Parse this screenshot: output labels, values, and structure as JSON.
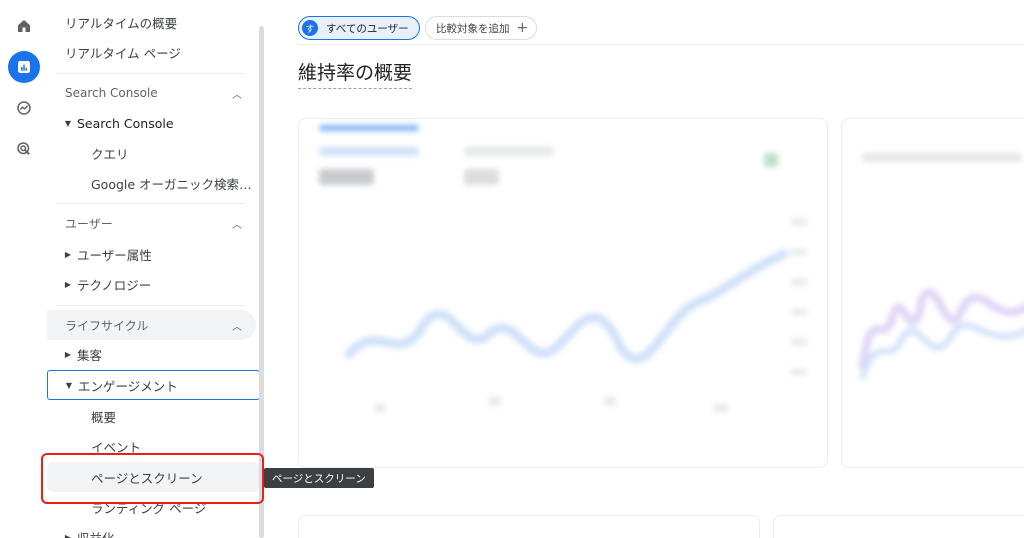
{
  "rail": {
    "icons": [
      "home-icon",
      "reports-icon",
      "explore-icon",
      "advertising-icon"
    ],
    "active": "reports-icon",
    "accent": "#1a73e8"
  },
  "sidebar": {
    "realtime_overview": "リアルタイムの概要",
    "realtime_pages": "リアルタイム ページ",
    "search_console_section": "Search Console",
    "search_console_group": "Search Console",
    "queries": "クエリ",
    "organic": "Google オーガニック検索レポート",
    "user_section": "ユーザー",
    "user_attributes": "ユーザー属性",
    "technology": "テクノロジー",
    "lifecycle_section": "ライフサイクル",
    "acquisition": "集客",
    "engagement": "エンゲージメント",
    "engagement_overview": "概要",
    "events": "イベント",
    "pages_screens": "ページとスクリーン",
    "landing_page": "ランディング ページ",
    "monetization": "収益化"
  },
  "tooltip": "ページとスクリーン",
  "main": {
    "all_users_badge": "す",
    "all_users": "すべてのユーザー",
    "add_comparison": "比較対象を追加",
    "title": "維持率の概要"
  },
  "colors": {
    "highlight_box": "#e8201a",
    "selected_outline": "#1a73e8"
  }
}
